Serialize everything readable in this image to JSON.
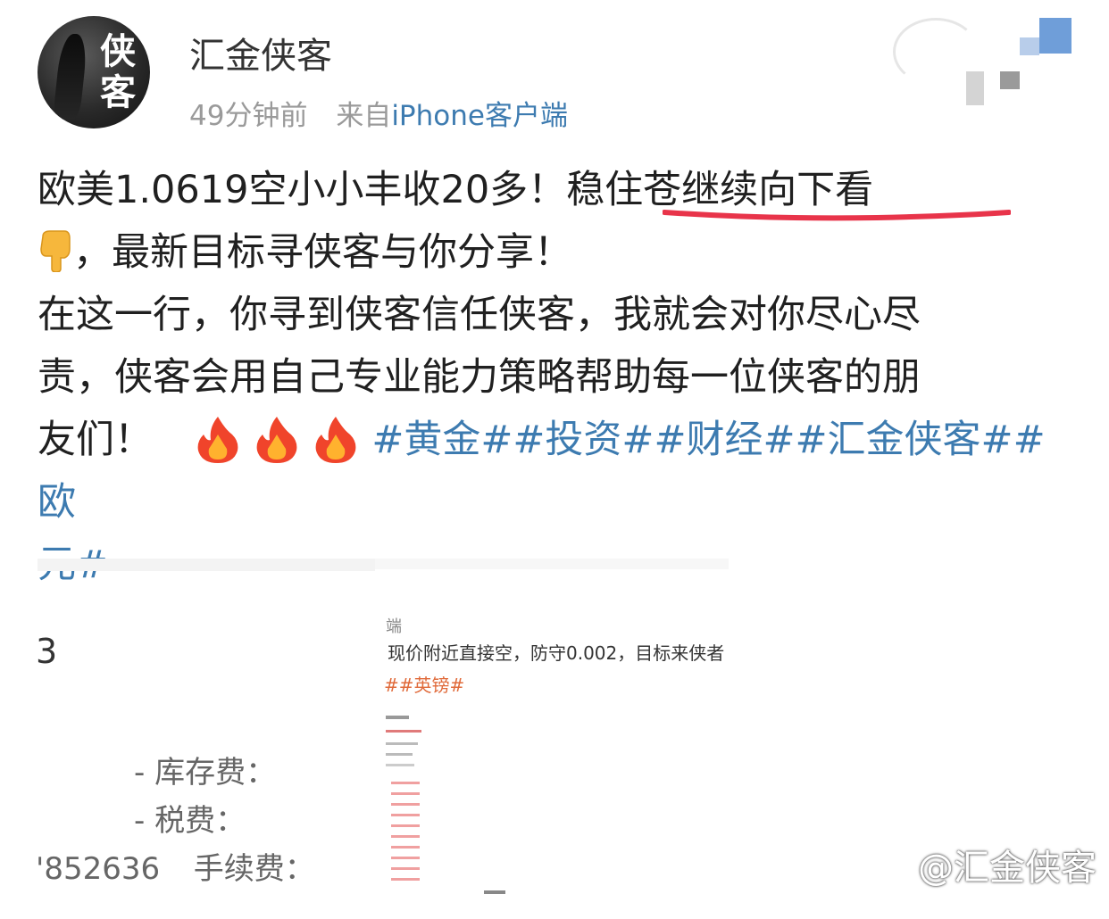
{
  "header": {
    "username": "汇金侠客",
    "time": "49分钟前",
    "source_prefix": "来自",
    "source": "iPhone客户端",
    "avatar_chars": [
      "侠",
      "客"
    ]
  },
  "post": {
    "line1_a": "欧美1.0619空小小丰收20多！",
    "line1_highlight": "稳住苍继续向下看",
    "line2": "，最新目标寻侠客与你分享！",
    "line3": "在这一行，你寻到侠客信任侠客，我就会对你尽心尽",
    "line4": "责，侠客会用自己专业能力策略帮助每一位侠客的朋",
    "line5_a": "友们！",
    "hashtags": "#黄金##投资##财经##汇金侠客##欧",
    "hashtags_cont": "元#"
  },
  "embedded": {
    "number_left": "3",
    "text_top": "端",
    "text_line": "现价附近直接空，防守0.002，目标来侠者",
    "text_tag": "##英镑#",
    "fees": [
      "-  库存费：",
      "-  税费：",
      "手续费："
    ],
    "account_partial": "'852636"
  },
  "watermark": "@汇金侠客",
  "colors": {
    "link": "#3d7bb0",
    "underline": "#e8344a",
    "meta": "#9a9a9a"
  },
  "icons": [
    "hand-pointing-down-icon",
    "fire-icon"
  ]
}
